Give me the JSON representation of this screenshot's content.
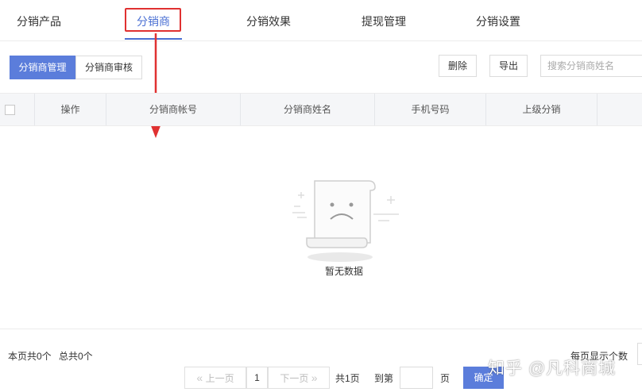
{
  "tabs": [
    {
      "label": "分销产品"
    },
    {
      "label": "分销商",
      "active": true
    },
    {
      "label": "分销效果"
    },
    {
      "label": "提现管理"
    },
    {
      "label": "分销设置"
    }
  ],
  "subtabs": [
    {
      "label": "分销商管理",
      "active": true
    },
    {
      "label": "分销商审核"
    }
  ],
  "toolbar": {
    "delete_label": "删除",
    "export_label": "导出",
    "search_placeholder": "搜索分销商姓名"
  },
  "table": {
    "columns": [
      "操作",
      "分销商帐号",
      "分销商姓名",
      "手机号码",
      "上级分销"
    ],
    "rows": []
  },
  "empty_text": "暂无数据",
  "footer": {
    "page_count": "本页共0个",
    "total_count": "总共0个",
    "per_page_label": "每页显示个数"
  },
  "pagination": {
    "prev_label": "上一页",
    "current_page": "1",
    "next_label": "下一页",
    "total_pages": "共1页",
    "goto_label": "到第",
    "page_unit": "页",
    "confirm_label": "确定"
  },
  "watermark": "知乎 @凡科商城",
  "colors": {
    "accent": "#4a6fd3",
    "primary_button": "#5b7ddb",
    "annotation_red": "#e03131"
  }
}
